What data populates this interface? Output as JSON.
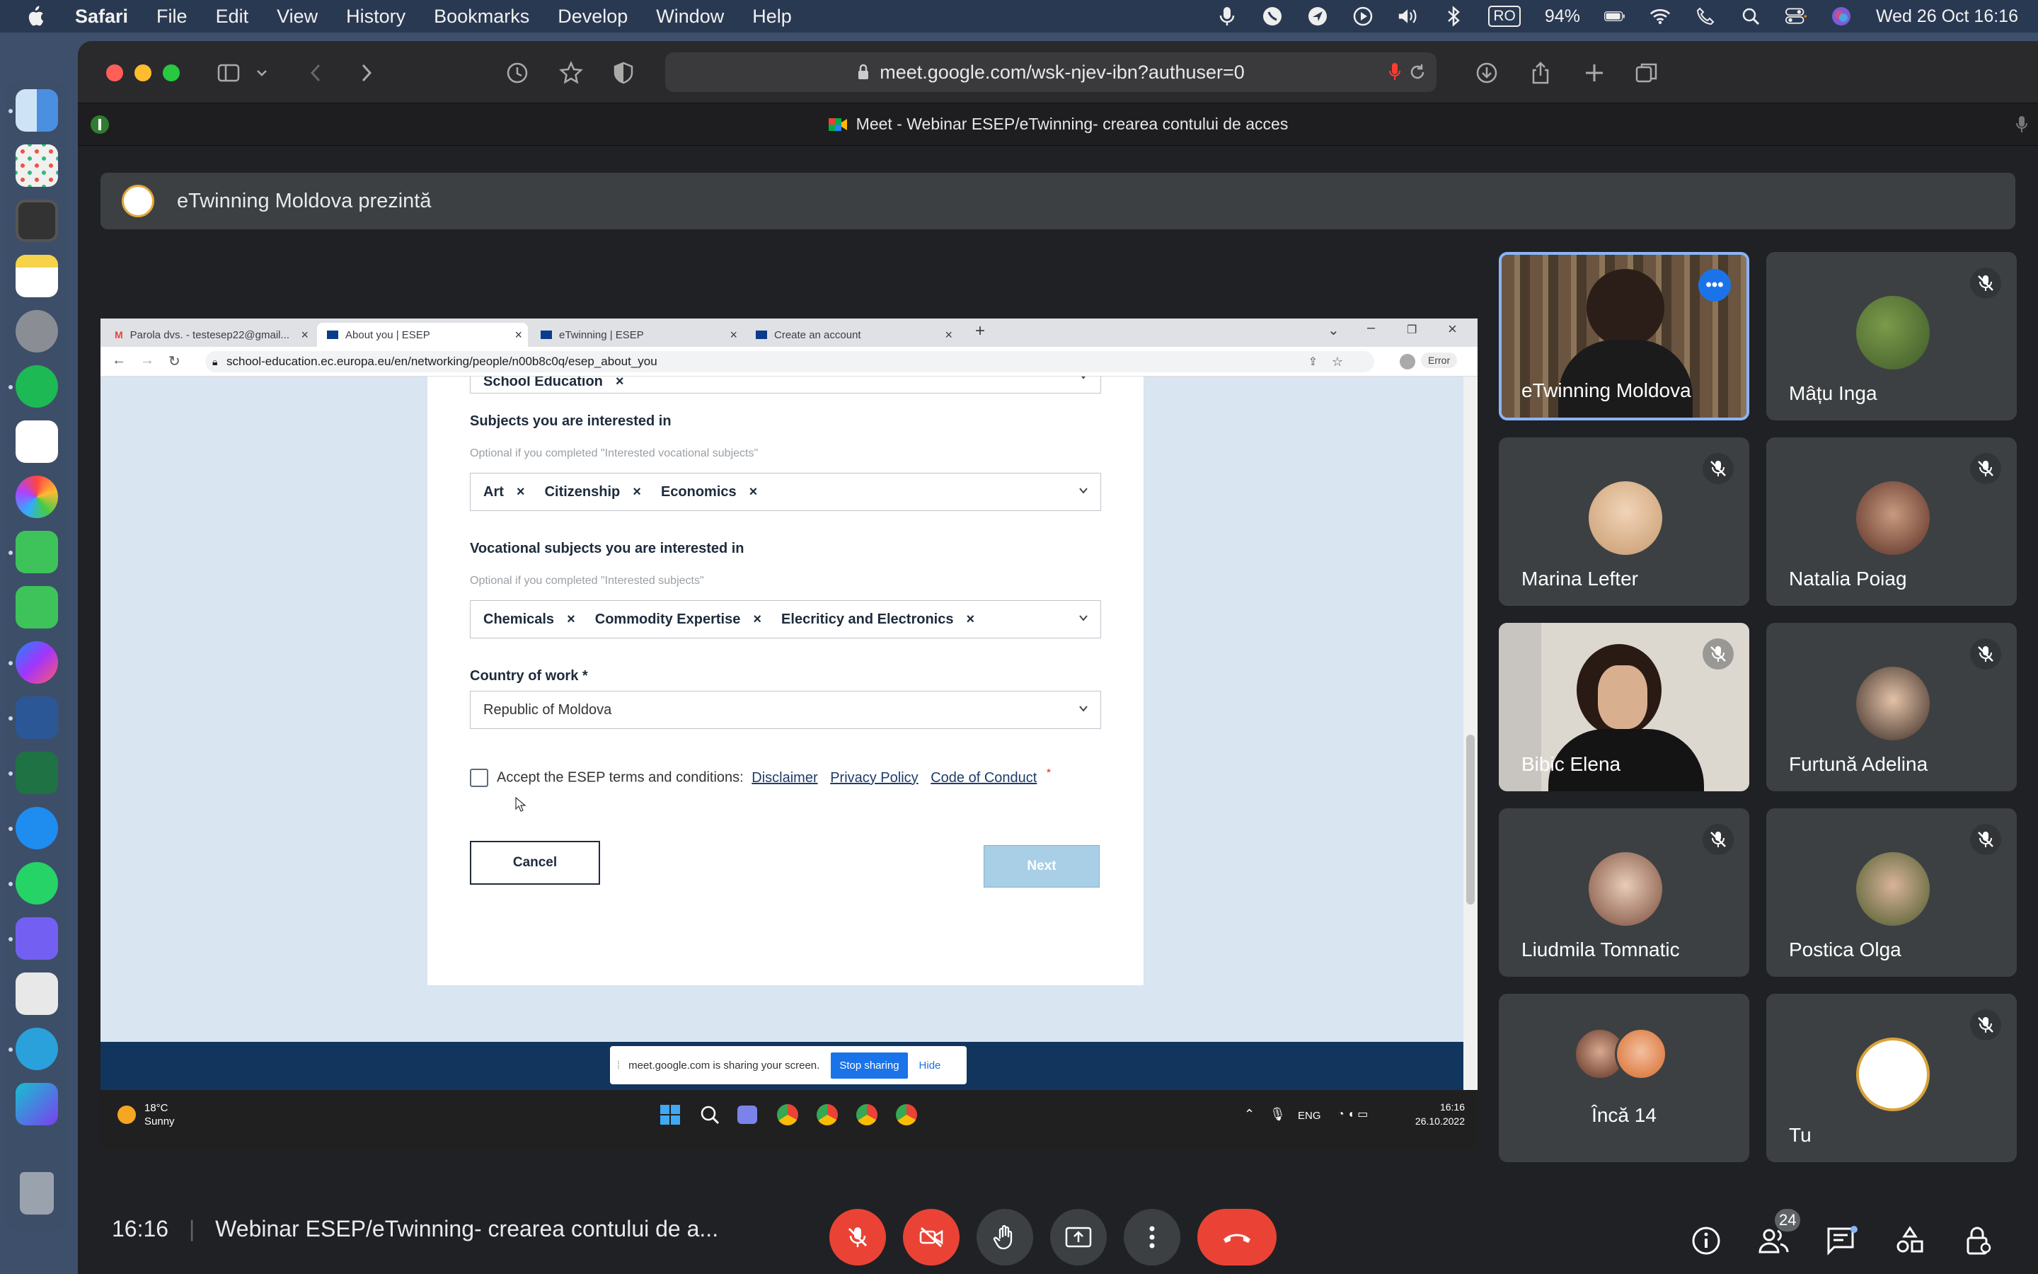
{
  "menubar": {
    "app": "Safari",
    "items": [
      "File",
      "Edit",
      "View",
      "History",
      "Bookmarks",
      "Develop",
      "Window",
      "Help"
    ],
    "input_source": "RO",
    "battery": "94%",
    "datetime": "Wed 26 Oct  16:16"
  },
  "browser": {
    "url": "meet.google.com/wsk-njev-ibn?authuser=0",
    "tab_title": "Meet - Webinar ESEP/eTwinning- crearea contului de acces"
  },
  "meet": {
    "presenter_banner": "eTwinning Moldova prezintă",
    "shared_screen": {
      "chrome_tabs": [
        {
          "label": "Parola dvs. - testesep22@gmail..."
        },
        {
          "label": "About you | ESEP"
        },
        {
          "label": "eTwinning | ESEP"
        },
        {
          "label": "Create an account"
        }
      ],
      "chrome_url": "school-education.ec.europa.eu/en/networking/people/n00b8c0q/esep_about_you",
      "error_badge": "Error",
      "form": {
        "top_chip": "School Education",
        "subjects_label": "Subjects you are interested in",
        "subjects_hint": "Optional if you completed \"Interested vocational subjects\"",
        "subjects": [
          "Art",
          "Citizenship",
          "Economics"
        ],
        "vocational_label": "Vocational subjects you are interested in",
        "vocational_hint": "Optional if you completed \"Interested subjects\"",
        "vocational": [
          "Chemicals",
          "Commodity Expertise",
          "Elecriticy and Electronics"
        ],
        "country_label": "Country of work *",
        "country_value": "Republic of Moldova",
        "terms_text": "Accept the ESEP terms and conditions:",
        "links": [
          "Disclaimer",
          "Privacy Policy",
          "Code of Conduct"
        ],
        "required_mark": "*",
        "cancel": "Cancel",
        "next": "Next"
      },
      "share_notice": {
        "text": "meet.google.com is sharing your screen.",
        "stop": "Stop sharing",
        "hide": "Hide"
      },
      "windows_taskbar": {
        "temp": "18°C",
        "weather": "Sunny",
        "lang": "ENG",
        "time": "16:16",
        "date": "26.10.2022"
      }
    },
    "participants": [
      {
        "name": "eTwinning Moldova"
      },
      {
        "name": "Mâțu Inga"
      },
      {
        "name": "Marina Lefter"
      },
      {
        "name": "Natalia Poiag"
      },
      {
        "name": "Bibic Elena"
      },
      {
        "name": "Furtună Adelina"
      },
      {
        "name": "Liudmila Tomnatic"
      },
      {
        "name": "Postica Olga"
      },
      {
        "name": "Încă 14"
      },
      {
        "name": "Tu"
      }
    ],
    "bottom": {
      "time": "16:16",
      "meeting_title": "Webinar ESEP/eTwinning- crearea contului de a...",
      "people_count": "24"
    },
    "colors": {
      "end_call": "#ea4335",
      "accent": "#8ab4f8",
      "tile": "#3c4043"
    }
  }
}
